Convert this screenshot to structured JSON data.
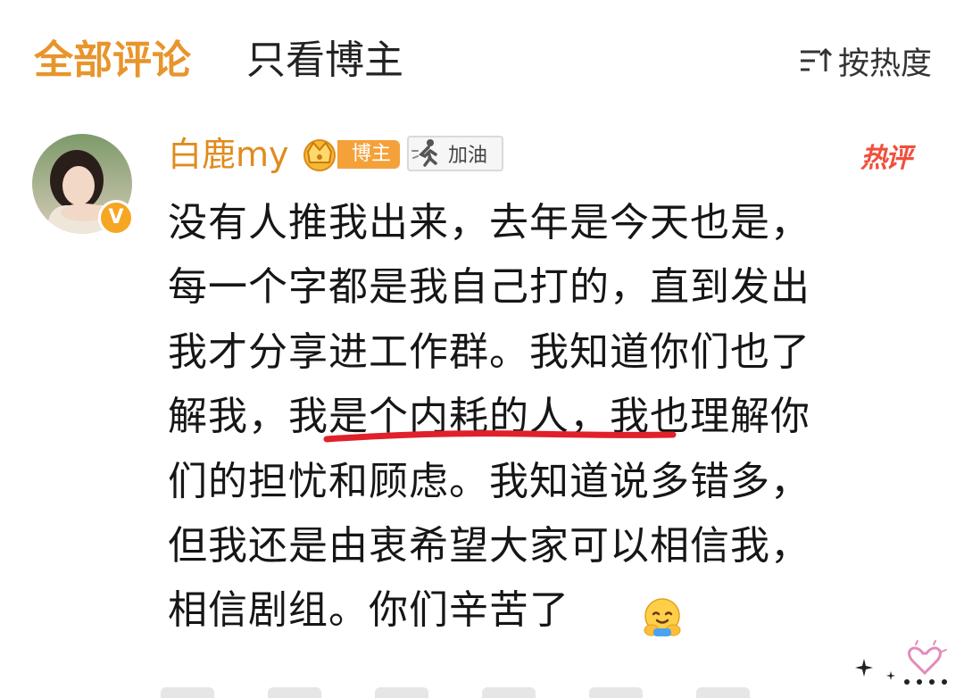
{
  "tabs": {
    "all_comments": "全部评论",
    "blogger_only": "只看博主"
  },
  "sort": {
    "label": "按热度",
    "icon": "sort-icon"
  },
  "comment": {
    "username": "白鹿my",
    "verified_badge": "V",
    "blogger_tag": "博主",
    "fan_badge_label": "加油",
    "hot_tag": "热评",
    "lines": [
      "没有人推我出来，去年是今天也是，",
      "每一个字都是我自己打的，直到发出",
      "我才分享进工作群。我知道你们也了",
      "解我，我是个内耗的人，我也理解你",
      "们的担忧和顾虑。我知道说多错多，",
      "但我还是由衷希望大家可以相信我，",
      "相信剧组。你们辛苦了"
    ],
    "emoji": "hug-emoji"
  },
  "colors": {
    "accent": "#e8952c",
    "username": "#e08b1f",
    "hot": "#f0503c",
    "underline": "#e0202a"
  }
}
